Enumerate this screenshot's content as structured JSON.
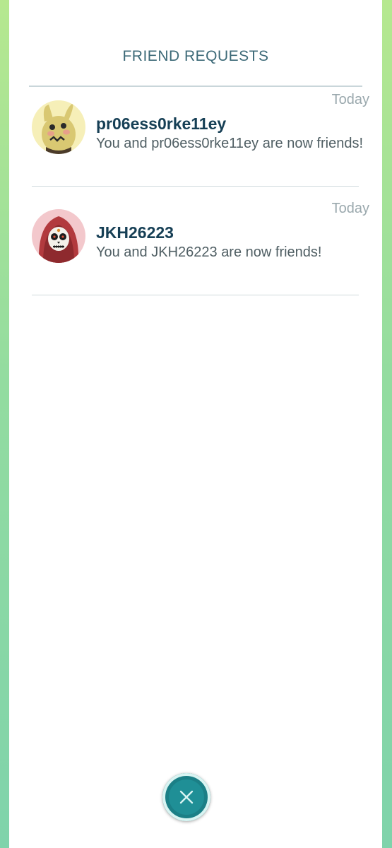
{
  "header": {
    "title": "FRIEND REQUESTS"
  },
  "requests": [
    {
      "date": "Today",
      "username": "pr06ess0rke11ey",
      "message": "You and pr06ess0rke11ey are now friends!",
      "avatar_icon": "mimikyu-costume-avatar-icon"
    },
    {
      "date": "Today",
      "username": "JKH26223",
      "message": "You and JKH26223 are now friends!",
      "avatar_icon": "sugar-skull-hood-avatar-icon"
    }
  ],
  "footer": {
    "close_icon": "close-icon"
  },
  "colors": {
    "accent": "#1b7f86",
    "title": "#3d6a78",
    "username": "#163f55",
    "background_gradient": [
      "#b6e88f",
      "#7fd3ab"
    ]
  }
}
